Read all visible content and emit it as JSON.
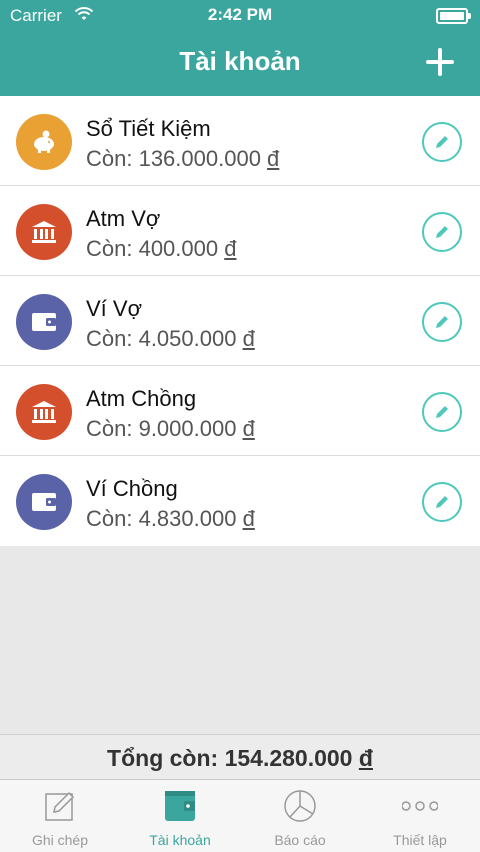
{
  "status": {
    "carrier": "Carrier",
    "time": "2:42 PM"
  },
  "nav": {
    "title": "Tài khoản",
    "add_icon": "plus-icon"
  },
  "colors": {
    "accent": "#3aa69e",
    "orange": "#e8a132",
    "red": "#d4502d",
    "purple": "#5b63a8",
    "edit": "#4dc8ba"
  },
  "accounts": [
    {
      "name": "Sổ Tiết Kiệm",
      "balance_prefix": "Còn: 136.000.000 ",
      "currency": "đ",
      "icon": "piggy-bank-icon",
      "color": "#e8a132"
    },
    {
      "name": "Atm Vợ",
      "balance_prefix": "Còn: 400.000 ",
      "currency": "đ",
      "icon": "bank-icon",
      "color": "#d4502d"
    },
    {
      "name": "Ví Vợ",
      "balance_prefix": "Còn: 4.050.000 ",
      "currency": "đ",
      "icon": "wallet-icon",
      "color": "#5b63a8"
    },
    {
      "name": "Atm Chồng",
      "balance_prefix": "Còn: 9.000.000 ",
      "currency": "đ",
      "icon": "bank-icon",
      "color": "#d4502d"
    },
    {
      "name": "Ví Chồng",
      "balance_prefix": "Còn: 4.830.000 ",
      "currency": "đ",
      "icon": "wallet-icon",
      "color": "#5b63a8"
    }
  ],
  "total": {
    "prefix": "Tổng còn: 154.280.000 ",
    "currency": "đ"
  },
  "tabs": [
    {
      "label": "Ghi chép",
      "icon": "edit-note-icon",
      "active": false
    },
    {
      "label": "Tài khoản",
      "icon": "wallet-icon",
      "active": true
    },
    {
      "label": "Báo cáo",
      "icon": "pie-chart-icon",
      "active": false
    },
    {
      "label": "Thiết lập",
      "icon": "more-icon",
      "active": false
    }
  ]
}
